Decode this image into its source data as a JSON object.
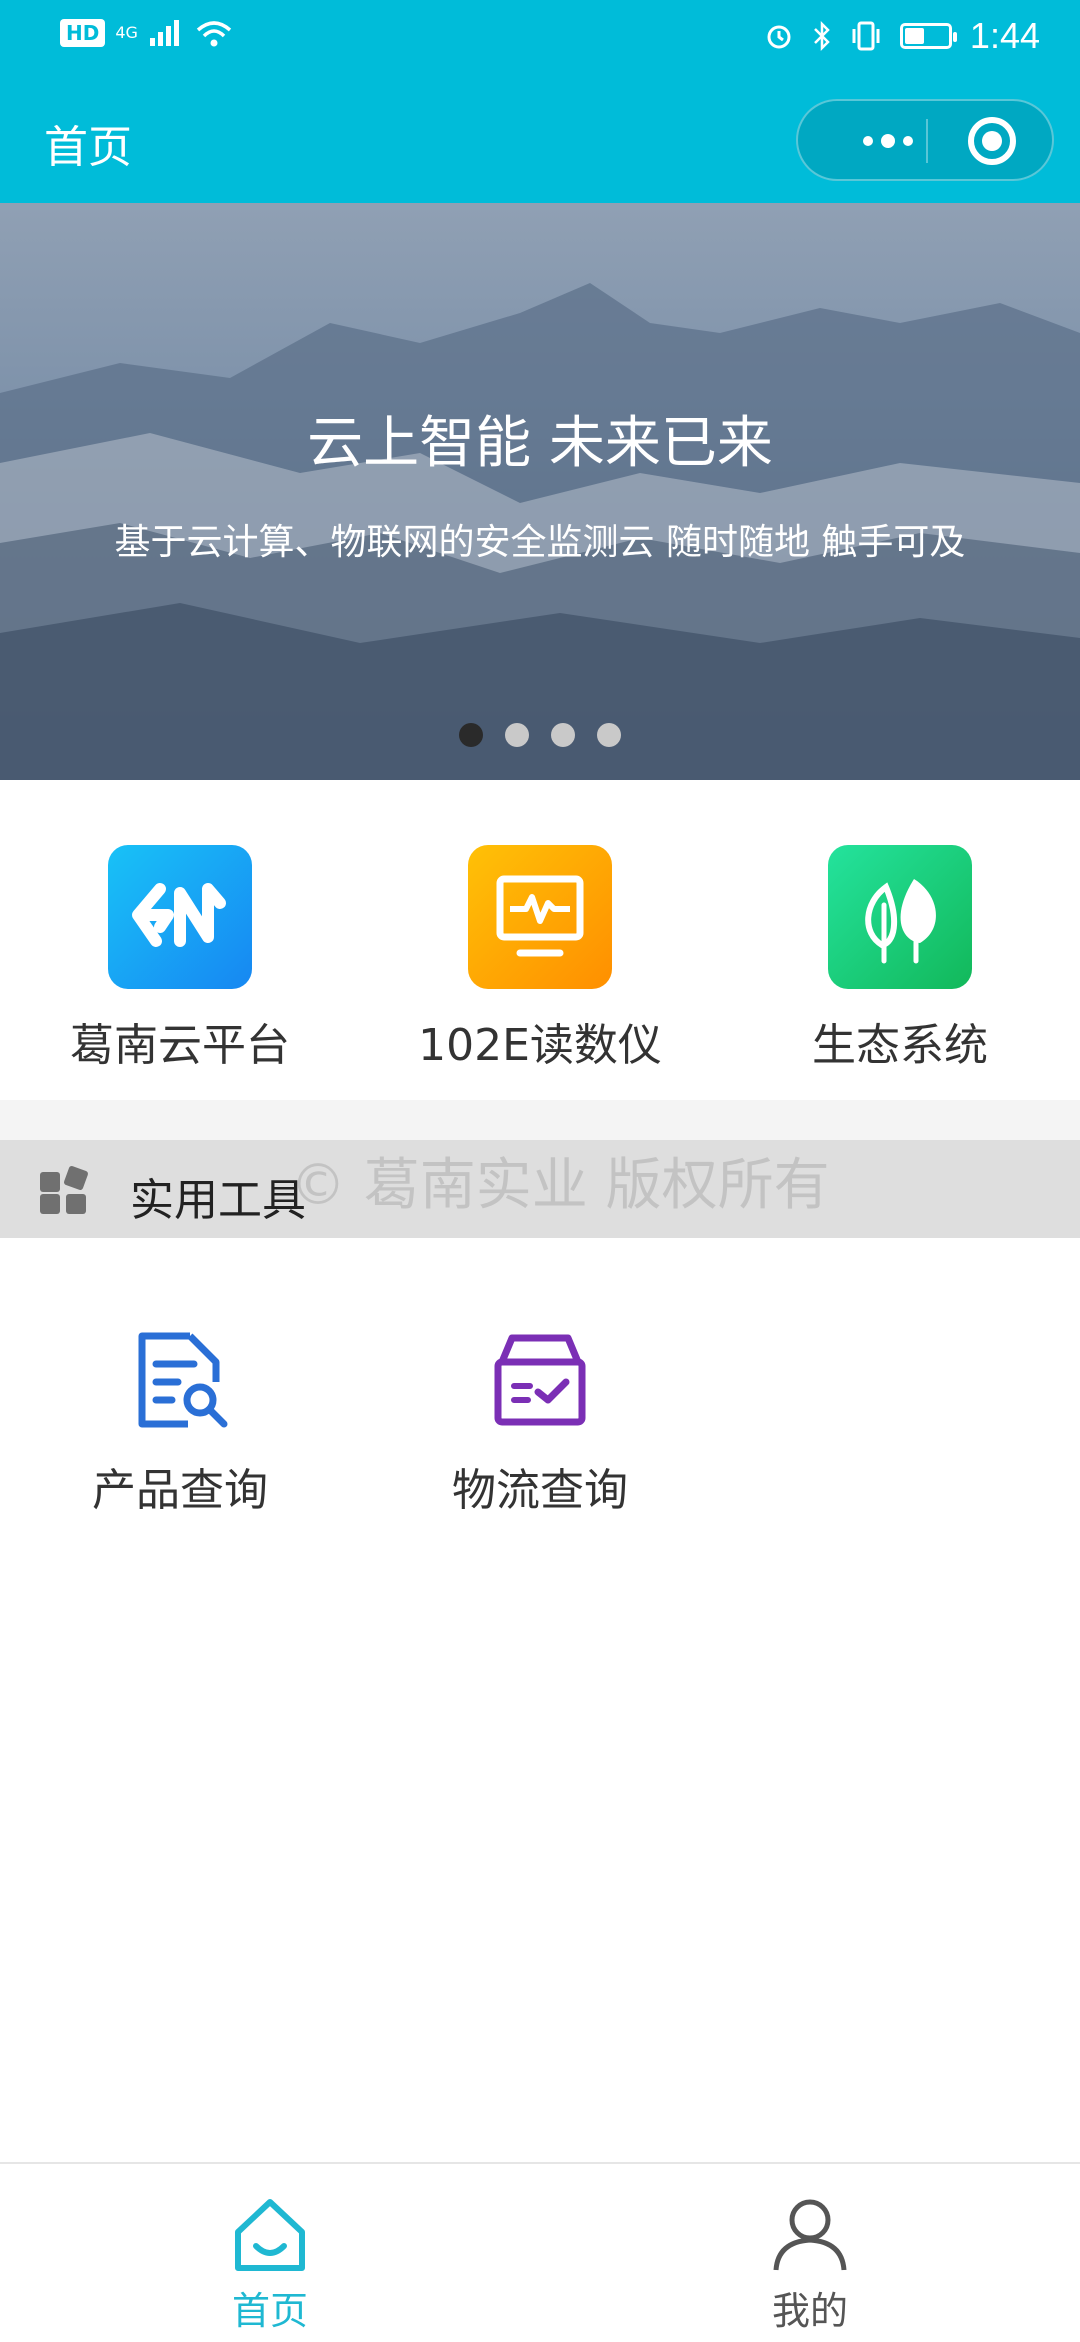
{
  "status_bar": {
    "network_hd": "HD",
    "network_gen": "4G",
    "time": "1:44",
    "battery_level": 0.45
  },
  "nav": {
    "title": "首页"
  },
  "banner": {
    "title": "云上智能 未来已来",
    "subtitle": "基于云计算、物联网的安全监测云 随时随地 触手可及",
    "dots_total": 4,
    "active_dot": 0
  },
  "apps": [
    {
      "label": "葛南云平台",
      "icon": "gn-logo-icon",
      "color": "#1aa0f0"
    },
    {
      "label": "102E读数仪",
      "icon": "monitor-pulse-icon",
      "color": "#ffa400"
    },
    {
      "label": "生态系统",
      "icon": "leaf-icon",
      "color": "#18cf6e"
    }
  ],
  "section": {
    "title": "实用工具",
    "icon": "grid-icon"
  },
  "watermark": "©    葛南实业 版权所有",
  "tools": [
    {
      "label": "产品查询",
      "icon": "document-search-icon",
      "color": "#2a6fd6"
    },
    {
      "label": "物流查询",
      "icon": "box-check-icon",
      "color": "#7b2fb5"
    }
  ],
  "tabbar": {
    "items": [
      {
        "label": "首页",
        "icon": "home-icon",
        "active": true,
        "color": "#1fb8d2"
      },
      {
        "label": "我的",
        "icon": "user-icon",
        "active": false,
        "color": "#555555"
      }
    ]
  }
}
